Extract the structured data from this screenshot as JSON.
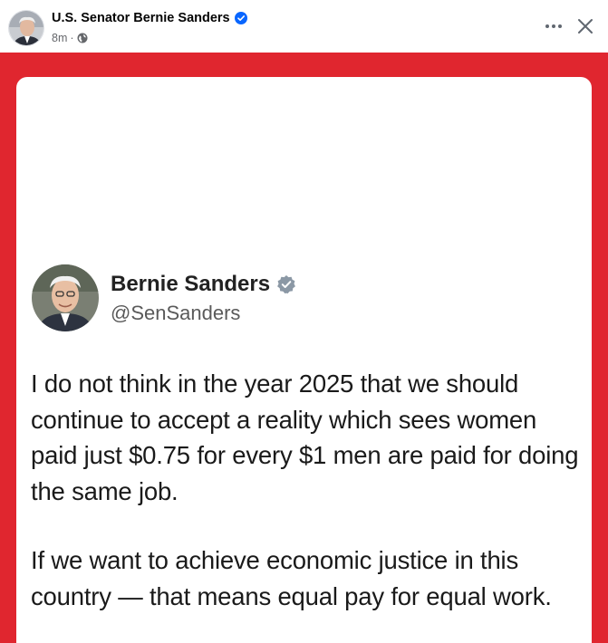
{
  "post": {
    "page_name": "U.S. Senator Bernie Sanders",
    "timestamp": "8m",
    "separator": "·",
    "audience_icon": "globe-icon",
    "actions": {
      "more_icon": "more-icon",
      "close_icon": "close-icon"
    }
  },
  "tweet": {
    "name": "Bernie Sanders",
    "handle": "@SenSanders",
    "paragraphs": [
      "I do not think in the year 2025 that we should continue to accept a reality which sees women paid just $0.75 for every $1 men are paid for doing the same job.",
      "If we want to achieve economic justice in this country — that means equal pay for equal work."
    ]
  },
  "colors": {
    "image_background": "#e0262f",
    "verified_blue": "#0866ff",
    "verified_gray": "#8b98a5",
    "meta_text": "#65676b"
  }
}
